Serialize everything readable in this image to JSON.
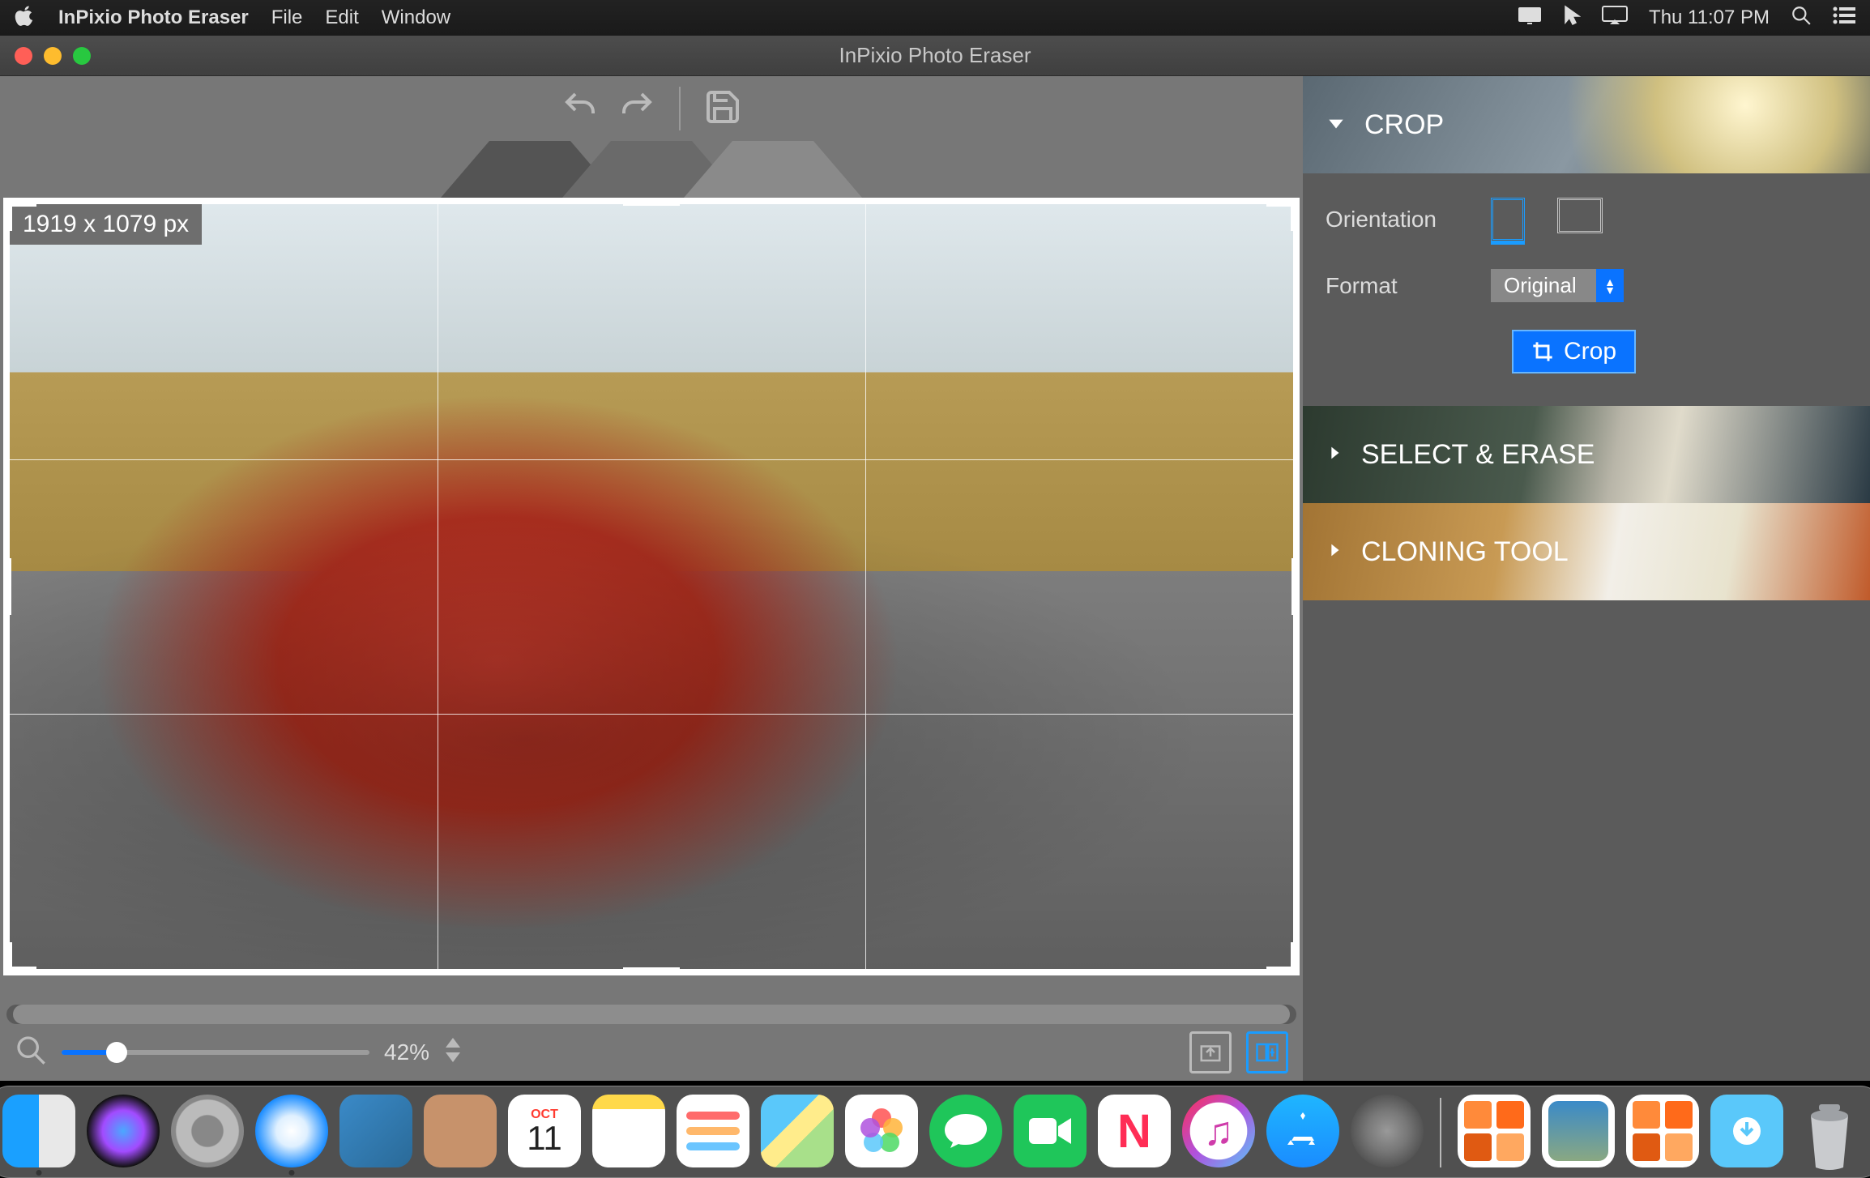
{
  "menubar": {
    "app_name": "InPixio Photo Eraser",
    "items": [
      "File",
      "Edit",
      "Window"
    ],
    "clock": "Thu 11:07 PM"
  },
  "window": {
    "title": "InPixio Photo Eraser"
  },
  "canvas": {
    "dimensions_label": "1919 x 1079 px",
    "zoom_percent": "42%"
  },
  "sidebar": {
    "crop": {
      "title": "CROP",
      "orientation_label": "Orientation",
      "format_label": "Format",
      "format_value": "Original",
      "crop_button": "Crop"
    },
    "erase": {
      "title": "SELECT & ERASE"
    },
    "clone": {
      "title": "CLONING TOOL"
    }
  },
  "dock": {
    "calendar_day": "11",
    "calendar_month": "OCT"
  },
  "colors": {
    "accent": "#0a73ff"
  }
}
